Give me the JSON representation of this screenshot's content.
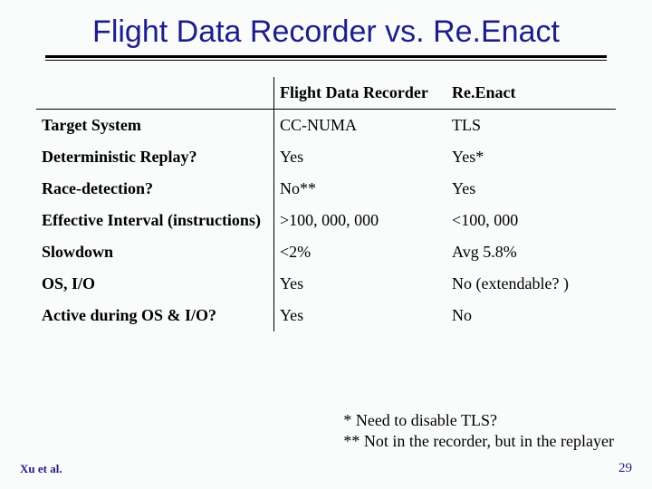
{
  "title": "Flight Data Recorder vs. Re.Enact",
  "columns": {
    "blank": "",
    "c1": "Flight Data Recorder",
    "c2": "Re.Enact"
  },
  "rows": [
    {
      "label": "Target System",
      "c1": "CC-NUMA",
      "c2": "TLS"
    },
    {
      "label": "Deterministic Replay?",
      "c1": "Yes",
      "c2": "Yes*"
    },
    {
      "label": "Race-detection?",
      "c1": "No**",
      "c2": "Yes"
    },
    {
      "label": "Effective Interval (instructions)",
      "c1": ">100, 000, 000",
      "c2": "<100, 000"
    },
    {
      "label": "Slowdown",
      "c1": "<2%",
      "c2": "Avg 5.8%"
    },
    {
      "label": "OS, I/O",
      "c1": "Yes",
      "c2": "No (extendable? )"
    },
    {
      "label": "Active during OS & I/O?",
      "c1": "Yes",
      "c2": "No"
    }
  ],
  "footnotes": {
    "f1": "* Need to disable TLS?",
    "f2": "** Not in the recorder, but in the replayer"
  },
  "footer": {
    "left": "Xu et al.",
    "right": "29"
  },
  "chart_data": {
    "type": "table",
    "title": "Flight Data Recorder vs. Re.Enact",
    "columns": [
      "",
      "Flight Data Recorder",
      "Re.Enact"
    ],
    "rows": [
      [
        "Target System",
        "CC-NUMA",
        "TLS"
      ],
      [
        "Deterministic Replay?",
        "Yes",
        "Yes*"
      ],
      [
        "Race-detection?",
        "No**",
        "Yes"
      ],
      [
        "Effective Interval (instructions)",
        ">100, 000, 000",
        "<100, 000"
      ],
      [
        "Slowdown",
        "<2%",
        "Avg 5.8%"
      ],
      [
        "OS, I/O",
        "Yes",
        "No (extendable? )"
      ],
      [
        "Active during OS & I/O?",
        "Yes",
        "No"
      ]
    ]
  }
}
